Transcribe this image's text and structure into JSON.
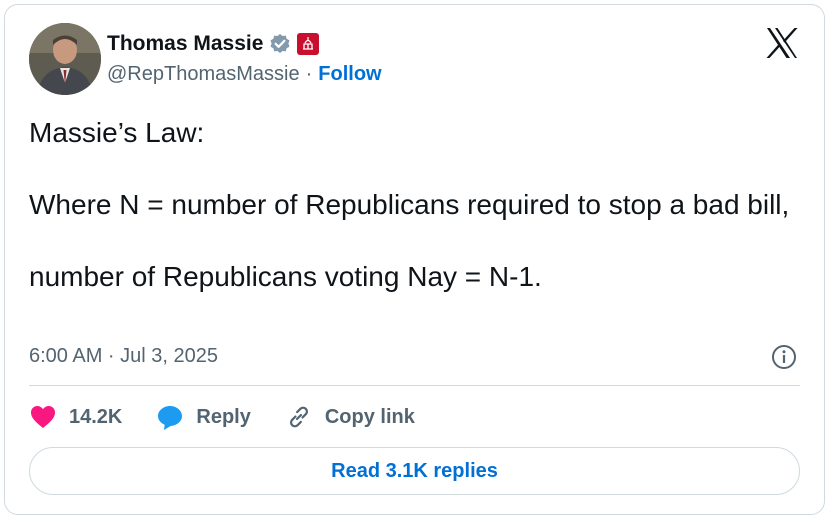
{
  "author": {
    "name": "Thomas Massie",
    "handle": "@RepThomasMassie",
    "separator": "·",
    "follow_label": "Follow"
  },
  "tweet": {
    "text": "Massie’s Law:\n\nWhere N = number of Republicans required to stop a bad bill,\n\nnumber of Republicans voting Nay = N-1.",
    "timestamp": "6:00 AM · Jul 3, 2025"
  },
  "actions": {
    "like_count": "14.2K",
    "reply_label": "Reply",
    "copy_label": "Copy link"
  },
  "read_replies_label": "Read 3.1K replies",
  "icons": {
    "platform": "x-logo-icon",
    "verified": "verified-badge-icon",
    "affiliation": "government-badge-icon",
    "info": "info-icon",
    "like": "heart-icon",
    "reply": "reply-bubble-icon",
    "copy": "link-icon"
  },
  "colors": {
    "accent": "#006fd6",
    "like": "#f91880",
    "reply": "#1d9bf0",
    "muted": "#536471",
    "border": "#cfd9de"
  }
}
